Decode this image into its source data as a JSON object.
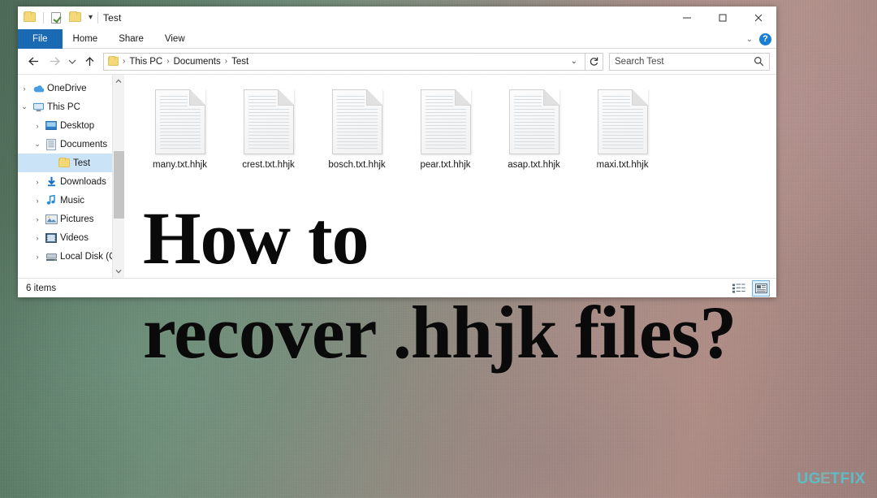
{
  "window": {
    "title": "Test",
    "quick_access": [
      {
        "name": "folder-icon",
        "label": "Folder"
      },
      {
        "name": "properties-icon",
        "label": "Properties"
      },
      {
        "name": "new-folder-icon",
        "label": "New folder"
      }
    ],
    "qat_dropdown": "▾",
    "controls": {
      "minimize": "Minimize",
      "maximize": "Maximize",
      "close": "Close"
    }
  },
  "ribbon": {
    "tabs": [
      {
        "label": "File",
        "active": true
      },
      {
        "label": "Home",
        "active": false
      },
      {
        "label": "Share",
        "active": false
      },
      {
        "label": "View",
        "active": false
      }
    ],
    "expand_chevron": "⌄",
    "help_label": "?"
  },
  "address": {
    "back": "Back",
    "forward": "Forward",
    "recent": "Recent locations",
    "up": "Up",
    "breadcrumbs": [
      "This PC",
      "Documents",
      "Test"
    ],
    "separator": "›",
    "dropdown_chevron": "⌄",
    "refresh": "Refresh"
  },
  "search": {
    "placeholder": "Search Test",
    "icon": "search-icon"
  },
  "sidebar": {
    "items": [
      {
        "label": "OneDrive",
        "icon": "onedrive-icon",
        "expander": "›",
        "indent": 0,
        "selected": false
      },
      {
        "label": "This PC",
        "icon": "this-pc-icon",
        "expander": "⌄",
        "indent": 0,
        "selected": false
      },
      {
        "label": "Desktop",
        "icon": "desktop-icon",
        "expander": "›",
        "indent": 1,
        "selected": false
      },
      {
        "label": "Documents",
        "icon": "documents-icon",
        "expander": "⌄",
        "indent": 1,
        "selected": false
      },
      {
        "label": "Test",
        "icon": "folder-icon",
        "expander": "",
        "indent": 2,
        "selected": true
      },
      {
        "label": "Downloads",
        "icon": "downloads-icon",
        "expander": "›",
        "indent": 1,
        "selected": false
      },
      {
        "label": "Music",
        "icon": "music-icon",
        "expander": "›",
        "indent": 1,
        "selected": false
      },
      {
        "label": "Pictures",
        "icon": "pictures-icon",
        "expander": "›",
        "indent": 1,
        "selected": false
      },
      {
        "label": "Videos",
        "icon": "videos-icon",
        "expander": "›",
        "indent": 1,
        "selected": false
      },
      {
        "label": "Local Disk (C:)",
        "icon": "local-disk-icon",
        "expander": "›",
        "indent": 1,
        "selected": false
      }
    ],
    "scroll_up": "⌃",
    "scroll_down": "⌄"
  },
  "files": [
    {
      "name": "many.txt.hhjk",
      "icon": "text-document-icon"
    },
    {
      "name": "crest.txt.hhjk",
      "icon": "text-document-icon"
    },
    {
      "name": "bosch.txt.hhjk",
      "icon": "text-document-icon"
    },
    {
      "name": "pear.txt.hhjk",
      "icon": "text-document-icon"
    },
    {
      "name": "asap.txt.hhjk",
      "icon": "text-document-icon"
    },
    {
      "name": "maxi.txt.hhjk",
      "icon": "text-document-icon"
    }
  ],
  "status": {
    "item_count": "6 items",
    "view_details": "details-view-icon",
    "view_large_icons": "large-icons-view-icon"
  },
  "overlay": {
    "line1": "How to",
    "line2": "recover .hhjk files?"
  },
  "watermark": {
    "part1": "UG",
    "part2": "E",
    "part3": "TFIX"
  },
  "colors": {
    "file_tab": "#1a6bb5",
    "selection": "#cce4f7",
    "help_blue": "#1a7fd4",
    "watermark_cyan": "#58c3d0",
    "headline": "#0a0a0a"
  }
}
